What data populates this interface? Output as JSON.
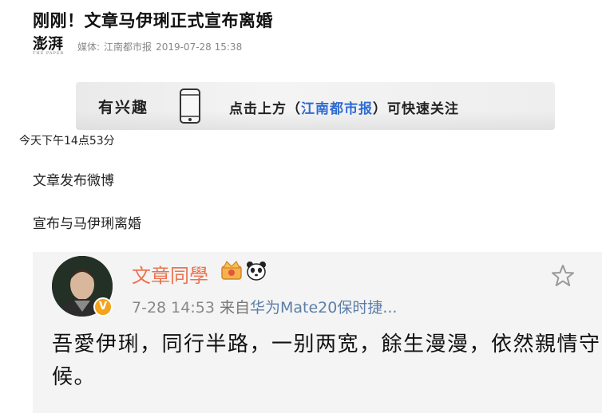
{
  "article": {
    "headline": "刚刚！文章马伊琍正式宣布离婚",
    "source_logo": "澎湃",
    "media_label": "媒体:",
    "media_name": "江南都市报",
    "published": "2019-07-28 15:38"
  },
  "follow_banner": {
    "left_text": "有兴趣",
    "icon": "phone-icon",
    "prefix": "点击上方（",
    "brand": "江南都市报",
    "suffix": "）可快速关注",
    "brand_color": "#2f6bd3"
  },
  "body": {
    "time_note": "今天下午14点53分",
    "para1": "文章发布微博",
    "para2": "宣布与马伊琍离婚"
  },
  "weibo": {
    "username": "文章同學",
    "name_color": "#eb7350",
    "verified_icon": "verified-v-icon",
    "badges": [
      "crown-icon",
      "panda-icon"
    ],
    "favorite_icon": "star-icon",
    "time": "7-28 14:53",
    "via": "来自",
    "device": "华为Mate20保时捷...",
    "content": "吾愛伊琍，同行半路，一别两宽，餘生漫漫，依然親情守候。"
  }
}
